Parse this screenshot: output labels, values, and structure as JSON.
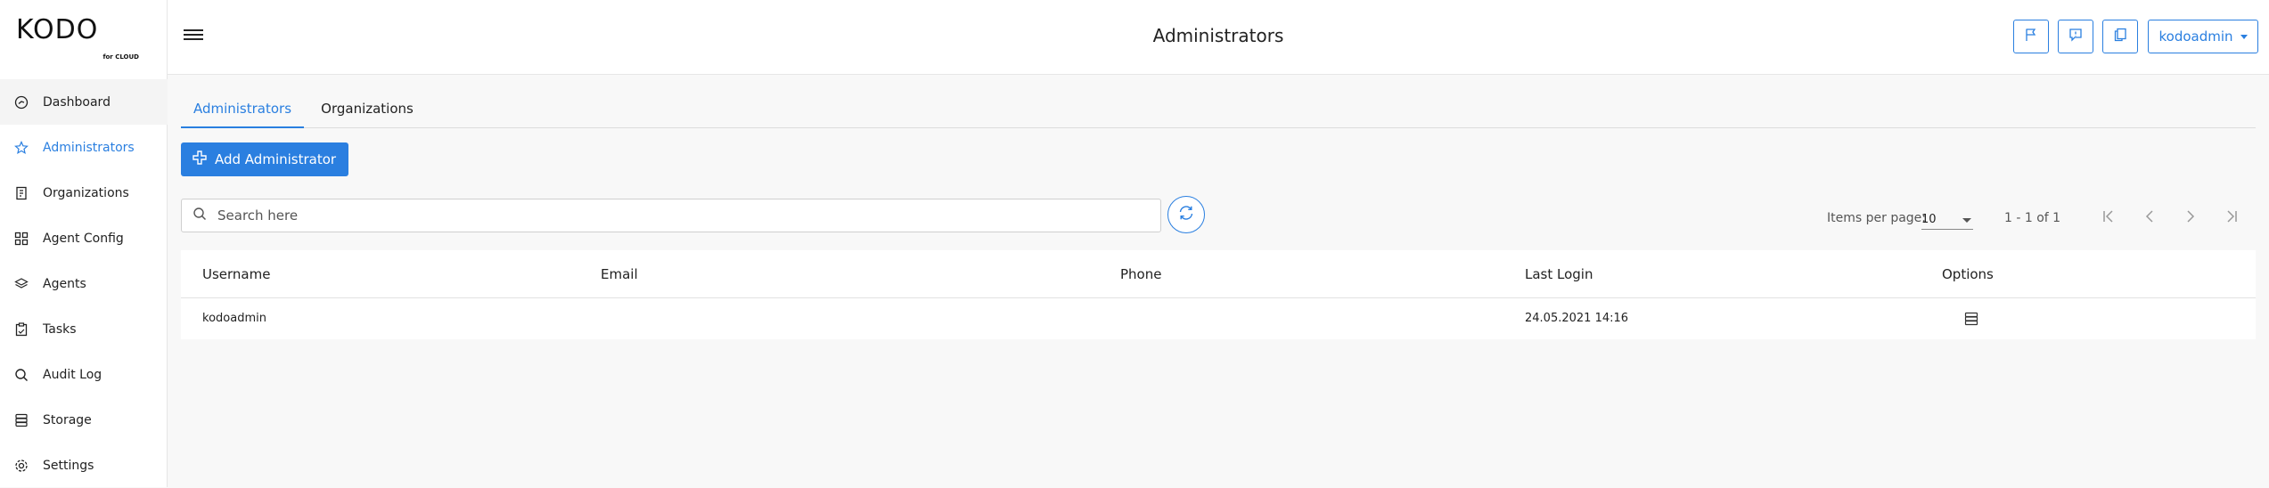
{
  "brand": {
    "logo_text": "KODO",
    "logo_sub": "for CLOUD"
  },
  "sidebar": {
    "items": [
      {
        "label": "Dashboard",
        "icon": "dashboard-icon"
      },
      {
        "label": "Administrators",
        "icon": "star-icon"
      },
      {
        "label": "Organizations",
        "icon": "building-icon"
      },
      {
        "label": "Agent Config",
        "icon": "grid-icon"
      },
      {
        "label": "Agents",
        "icon": "layers-icon"
      },
      {
        "label": "Tasks",
        "icon": "clipboard-icon"
      },
      {
        "label": "Audit Log",
        "icon": "search-icon"
      },
      {
        "label": "Storage",
        "icon": "database-icon"
      },
      {
        "label": "Settings",
        "icon": "gear-icon"
      }
    ]
  },
  "header": {
    "title": "Administrators",
    "user_label": "kodoadmin"
  },
  "tabs": [
    {
      "label": "Administrators"
    },
    {
      "label": "Organizations"
    }
  ],
  "actions": {
    "add_label": "Add Administrator"
  },
  "search": {
    "placeholder": "Search here",
    "value": ""
  },
  "paginator": {
    "items_per_page_label": "Items per page:",
    "page_size": "10",
    "range_label": "1 - 1 of 1"
  },
  "table": {
    "columns": [
      "Username",
      "Email",
      "Phone",
      "Last Login",
      "Options"
    ],
    "rows": [
      {
        "username": "kodoadmin",
        "email": "",
        "phone": "",
        "last_login": "24.05.2021 14:16"
      }
    ]
  },
  "colors": {
    "accent": "#2a7fe0",
    "text": "#222222",
    "background": "#f8f8f8"
  }
}
